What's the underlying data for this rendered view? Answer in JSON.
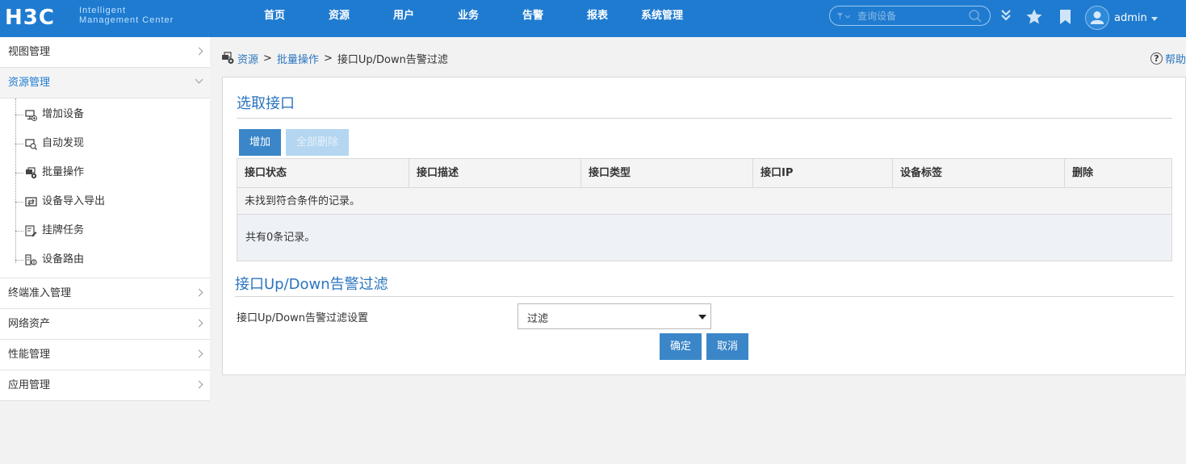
{
  "header": {
    "logo_mark": "H3C",
    "logo_line1": "Intelligent",
    "logo_line2": "Management Center",
    "nav": [
      "首页",
      "资源",
      "用户",
      "业务",
      "告警",
      "报表",
      "系统管理"
    ],
    "search_placeholder": "查询设备",
    "username": "admin",
    "accent": "#1f7bd0"
  },
  "sidebar": {
    "sections_top": [
      {
        "label": "视图管理",
        "icon": "chevron-right-icon"
      }
    ],
    "open_section": {
      "label": "资源管理",
      "icon": "chevron-down-icon"
    },
    "sub_items": [
      {
        "label": "增加设备",
        "icon": "add-device-icon"
      },
      {
        "label": "自动发现",
        "icon": "auto-discover-icon"
      },
      {
        "label": "批量操作",
        "icon": "batch-operation-icon"
      },
      {
        "label": "设备导入导出",
        "icon": "import-export-icon"
      },
      {
        "label": "挂牌任务",
        "icon": "tag-task-icon"
      },
      {
        "label": "设备路由",
        "icon": "device-route-icon"
      }
    ],
    "sections_bottom": [
      {
        "label": "终端准入管理"
      },
      {
        "label": "网络资产"
      },
      {
        "label": "性能管理"
      },
      {
        "label": "应用管理"
      }
    ]
  },
  "breadcrumb": {
    "items": [
      "资源",
      "批量操作"
    ],
    "current": "接口Up/Down告警过滤",
    "separator": ">"
  },
  "help_label": "帮助",
  "select_interface": {
    "title": "选取接口",
    "add_button": "增加",
    "delete_all_button": "全部删除",
    "columns": [
      "接口状态",
      "接口描述",
      "接口类型",
      "接口IP",
      "设备标签",
      "删除"
    ],
    "empty_message": "未找到符合条件的记录。",
    "total_text": "共有0条记录。"
  },
  "filter": {
    "title": "接口Up/Down告警过滤",
    "setting_label": "接口Up/Down告警过滤设置",
    "selected_value": "过滤",
    "confirm_button": "确定",
    "cancel_button": "取消"
  }
}
